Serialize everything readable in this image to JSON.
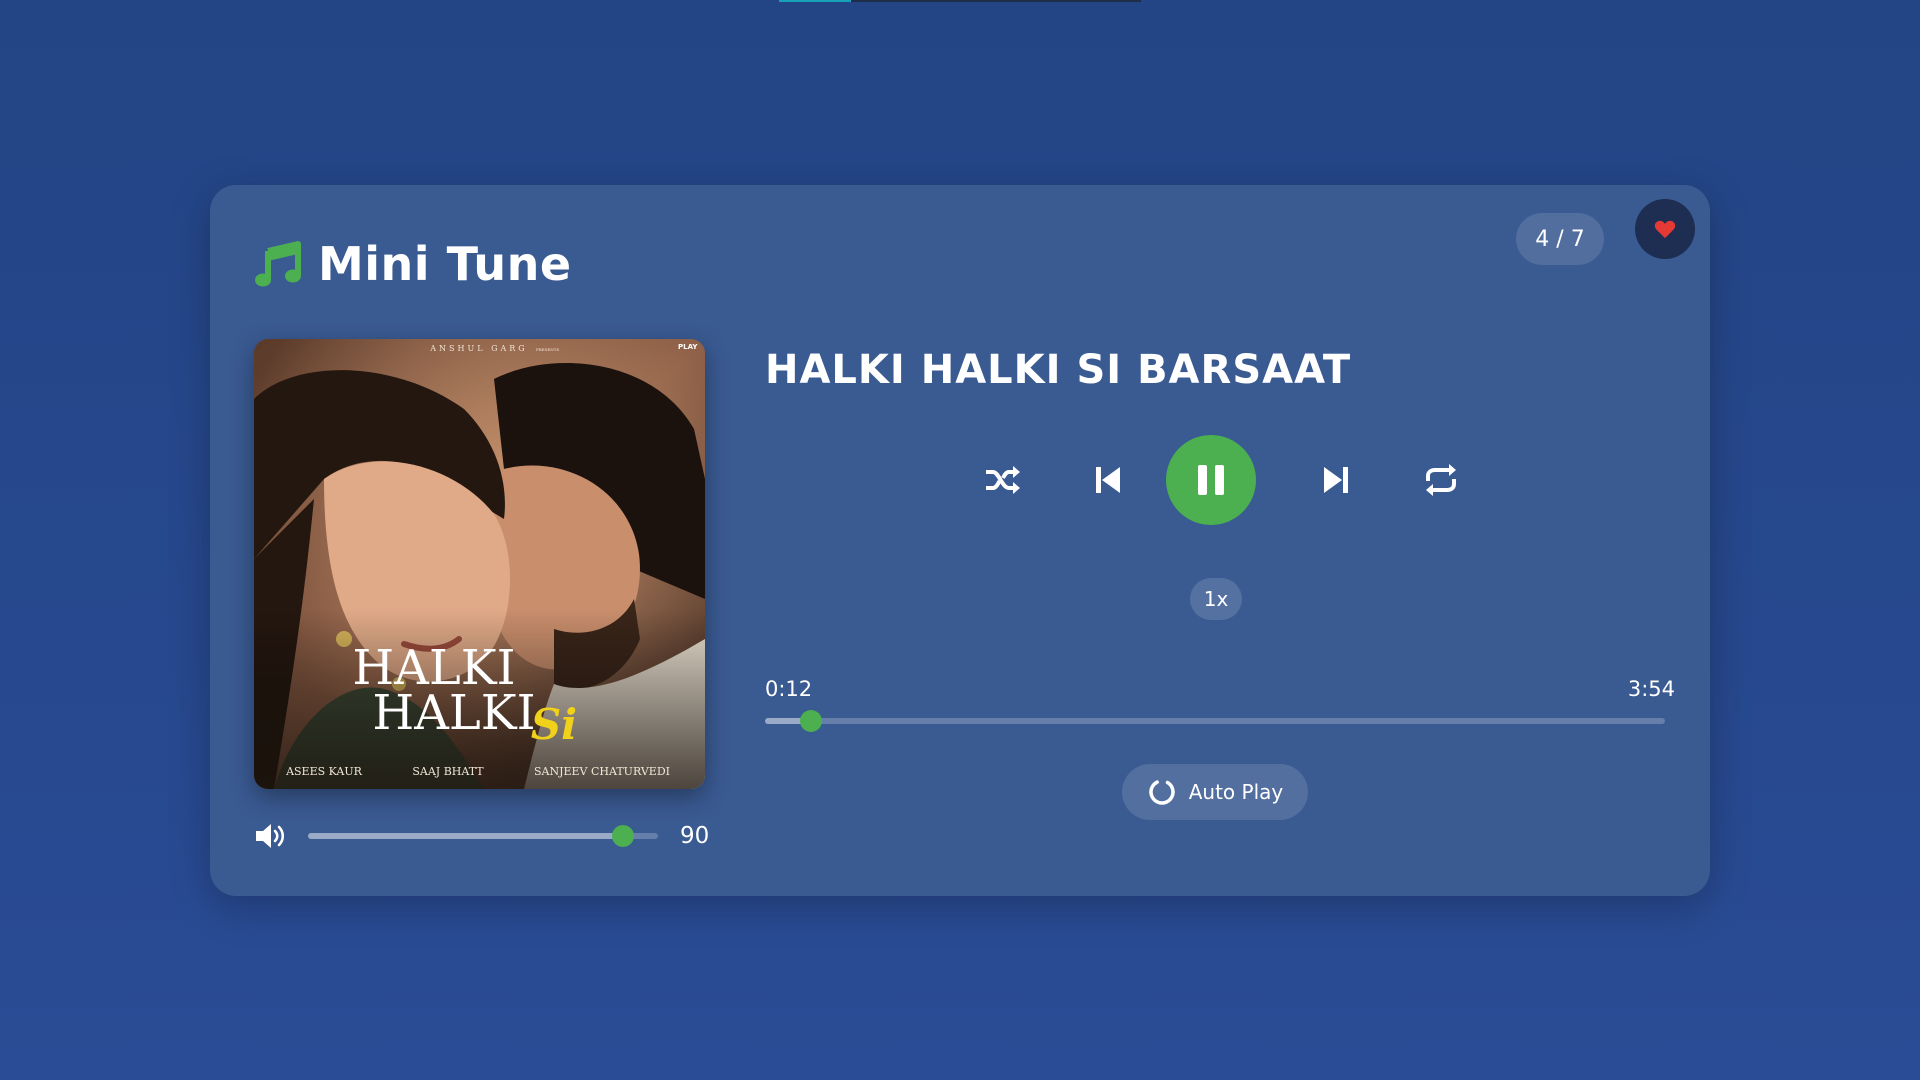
{
  "loading_bar": {
    "progress": 0.2
  },
  "app": {
    "title": "Mini Tune"
  },
  "header": {
    "track_counter": "4 / 7",
    "favorite_icon": "heart-icon"
  },
  "track": {
    "title": "HALKI HALKI SI BARSAAT",
    "album_art": {
      "top_text": "ANSHUL GARG",
      "presents": "PRESENTS",
      "corner_label": "PLAY",
      "title_line1": "HALKI",
      "title_line2": "HALKI",
      "title_script": "Si",
      "credits": [
        "ASEES KAUR",
        "SAAJ BHATT",
        "SANJEEV CHATURVEDI"
      ]
    }
  },
  "controls": {
    "shuffle_icon": "shuffle-icon",
    "prev_icon": "skip-back-icon",
    "play_pause_icon": "pause-icon",
    "next_icon": "skip-forward-icon",
    "repeat_icon": "repeat-icon",
    "speed": "1x"
  },
  "progress": {
    "current": "0:12",
    "total": "3:54",
    "current_seconds": 12,
    "total_seconds": 234
  },
  "volume": {
    "value": "90",
    "level": 0.9,
    "icon": "volume-icon"
  },
  "autoplay": {
    "label": "Auto Play",
    "icon": "loading-circle-icon"
  },
  "colors": {
    "accent": "#4cb050",
    "card": "#3a5a92",
    "background": "#234585",
    "favorite": "#e53935"
  }
}
